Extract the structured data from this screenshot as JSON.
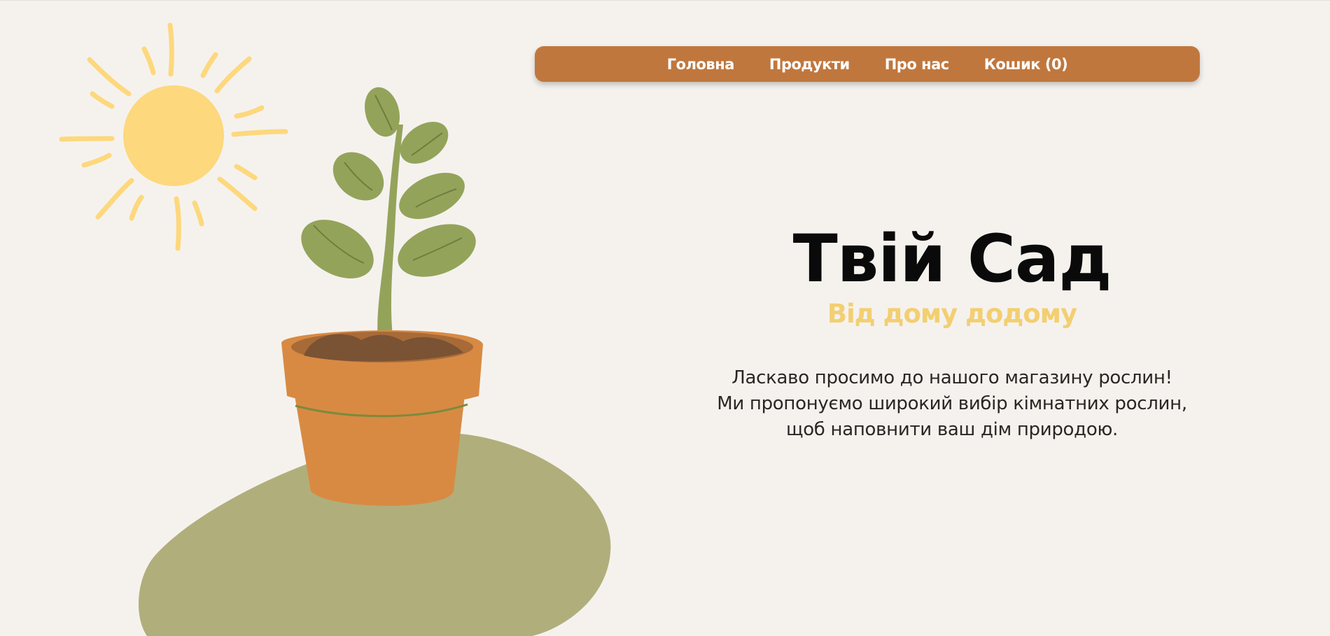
{
  "nav": {
    "items": [
      {
        "label": "Головна"
      },
      {
        "label": "Продукти"
      },
      {
        "label": "Про нас"
      },
      {
        "label": "Кошик (0)"
      }
    ]
  },
  "hero": {
    "title": "Твій Сад",
    "tagline": "Від дому додому",
    "intro_lines": [
      "Ласкаво просимо до нашого магазину рослин!",
      "Ми пропонуємо широкий вибір кімнатних рослин,",
      "щоб наповнити ваш дім природою."
    ]
  },
  "colors": {
    "background": "#f5f2ee",
    "nav_background": "#c0773d",
    "title": "#0a0a0a",
    "tagline": "#f3cf72",
    "sun": "#fdd87c",
    "blob": "#b0af7b",
    "pot": "#d88a43",
    "leaf": "#94a35a"
  },
  "illustration": {
    "icons": [
      "sun-icon",
      "plant-pot-icon",
      "ground-blob"
    ]
  }
}
